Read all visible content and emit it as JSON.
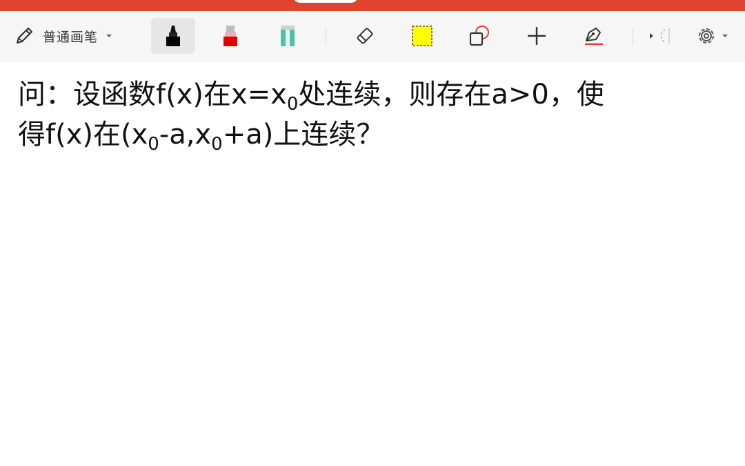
{
  "toolbar": {
    "pen_mode_label": "普通画笔",
    "tools": [
      {
        "name": "pen-mode",
        "icon": "pencil-icon"
      },
      {
        "name": "black-marker",
        "icon": "marker-icon",
        "color": "#111111",
        "selected": true
      },
      {
        "name": "red-marker",
        "icon": "marker-icon",
        "color": "#e30000"
      },
      {
        "name": "teal-highlighter",
        "icon": "highlighter-icon",
        "color": "#4fc1a9"
      },
      {
        "name": "eraser",
        "icon": "eraser-icon"
      },
      {
        "name": "selection",
        "icon": "dashed-rectangle-icon",
        "color": "#ffff00"
      },
      {
        "name": "shapes",
        "icon": "shapes-icon",
        "color": "#e0432f"
      },
      {
        "name": "add",
        "icon": "plus-icon"
      },
      {
        "name": "fountain-pen",
        "icon": "fountain-pen-icon",
        "color": "#e0432f"
      },
      {
        "name": "laser",
        "icon": "laser-icon"
      },
      {
        "name": "settings",
        "icon": "gear-icon"
      }
    ]
  },
  "question": {
    "line1_a": "问：设函数f(x)在x=x",
    "line1_sub": "0",
    "line1_b": "处连续，则存在a>0，使",
    "line2_a": "得f(x)在(x",
    "line2_sub1": "0",
    "line2_b": "-a,x",
    "line2_sub2": "0",
    "line2_c": "+a)上连续？"
  }
}
